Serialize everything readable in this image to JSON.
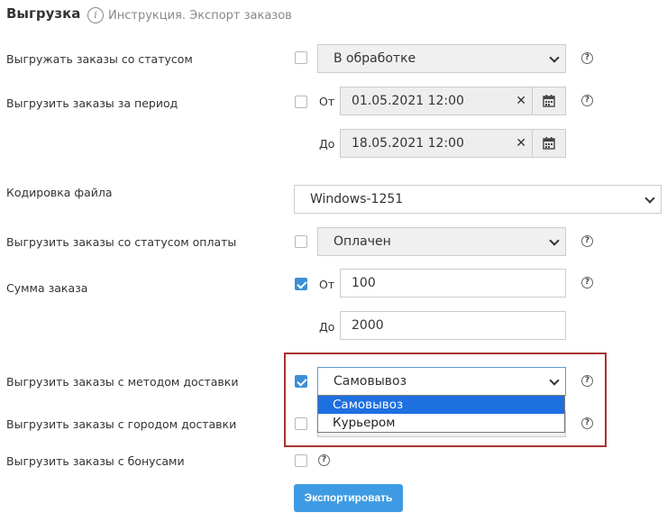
{
  "header": {
    "title": "Выгрузка",
    "instruction_link": "Инструкция. Экспорт заказов"
  },
  "rows": {
    "order_status": {
      "label": "Выгружать заказы со статусом",
      "checked": false,
      "select_value": "В обработке"
    },
    "period": {
      "label": "Выгрузить заказы за период",
      "checked": false,
      "from_label": "От",
      "from_value": "01.05.2021 12:00",
      "to_label": "До",
      "to_value": "18.05.2021 12:00"
    },
    "encoding": {
      "label": "Кодировка файла",
      "select_value": "Windows-1251"
    },
    "payment_status": {
      "label": "Выгрузить заказы со статусом оплаты",
      "checked": false,
      "select_value": "Оплачен"
    },
    "order_sum": {
      "label": "Сумма заказа",
      "checked": true,
      "from_label": "От",
      "from_value": "100",
      "to_label": "До",
      "to_value": "2000"
    },
    "delivery_method": {
      "label": "Выгрузить заказы с методом доставки",
      "checked": true,
      "select_value": "Самовывоз",
      "options": [
        "Самовывоз",
        "Курьером"
      ],
      "selected_index": 0
    },
    "delivery_city": {
      "label": "Выгрузить заказы с городом доставки",
      "checked": false
    },
    "bonuses": {
      "label": "Выгрузить заказы с бонусами",
      "checked": false
    }
  },
  "export_button": "Экспортировать",
  "icons": {
    "help": "?",
    "info": "i",
    "clear": "✕"
  },
  "colors": {
    "accent": "#3e9be3",
    "checked": "#3d8fd6",
    "highlight_border": "#a83232",
    "option_selected": "#1e6fe0"
  }
}
